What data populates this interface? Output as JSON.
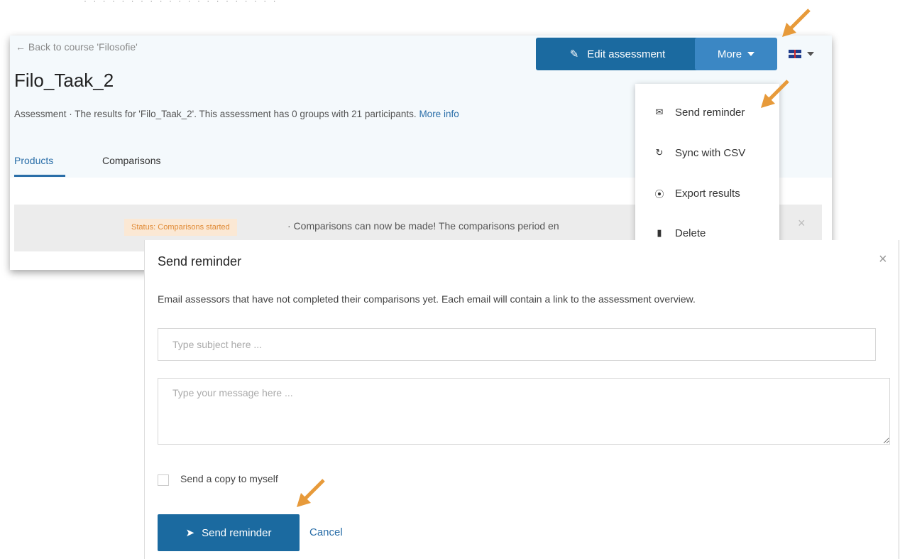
{
  "top_crop_text": "· · · · · · · · · · · · · · · · · · · · ·",
  "page": {
    "back_link": "← Back to course 'Filosofie'",
    "title": "Filo_Taak_2",
    "subtitle": "Assessment · The results for 'Filo_Taak_2'. This assessment has 0 groups with 21 participants.",
    "more_info": "More info",
    "tabs": [
      {
        "label": "Products"
      },
      {
        "label": "Comparisons"
      }
    ],
    "edit_button": "Edit assessment",
    "more_button": "More",
    "status_badge": "Status: Comparisons started",
    "status_text": "· Comparisons can now be made! The comparisons period en",
    "status_close": "×"
  },
  "dropdown": {
    "items": [
      {
        "label": "Send reminder",
        "icon": "envelope-icon"
      },
      {
        "label": "Sync with CSV",
        "icon": "refresh-icon"
      },
      {
        "label": "Export results",
        "icon": "export-icon"
      },
      {
        "label": "Delete",
        "icon": "trash-icon"
      }
    ]
  },
  "modal": {
    "title": "Send reminder",
    "close": "×",
    "description": "Email assessors that have not completed their comparisons yet. Each email will contain a link to the assessment overview.",
    "subject_placeholder": "Type subject here ...",
    "message_placeholder": "Type your message here ...",
    "copy_label": "Send a copy to myself",
    "copy_checked": false,
    "send_button": "Send reminder",
    "cancel": "Cancel"
  },
  "colors": {
    "primary": "#1b6aa0",
    "secondary": "#3b87c4",
    "link": "#2a6ea8",
    "annotation_arrow": "#e79a3a"
  }
}
